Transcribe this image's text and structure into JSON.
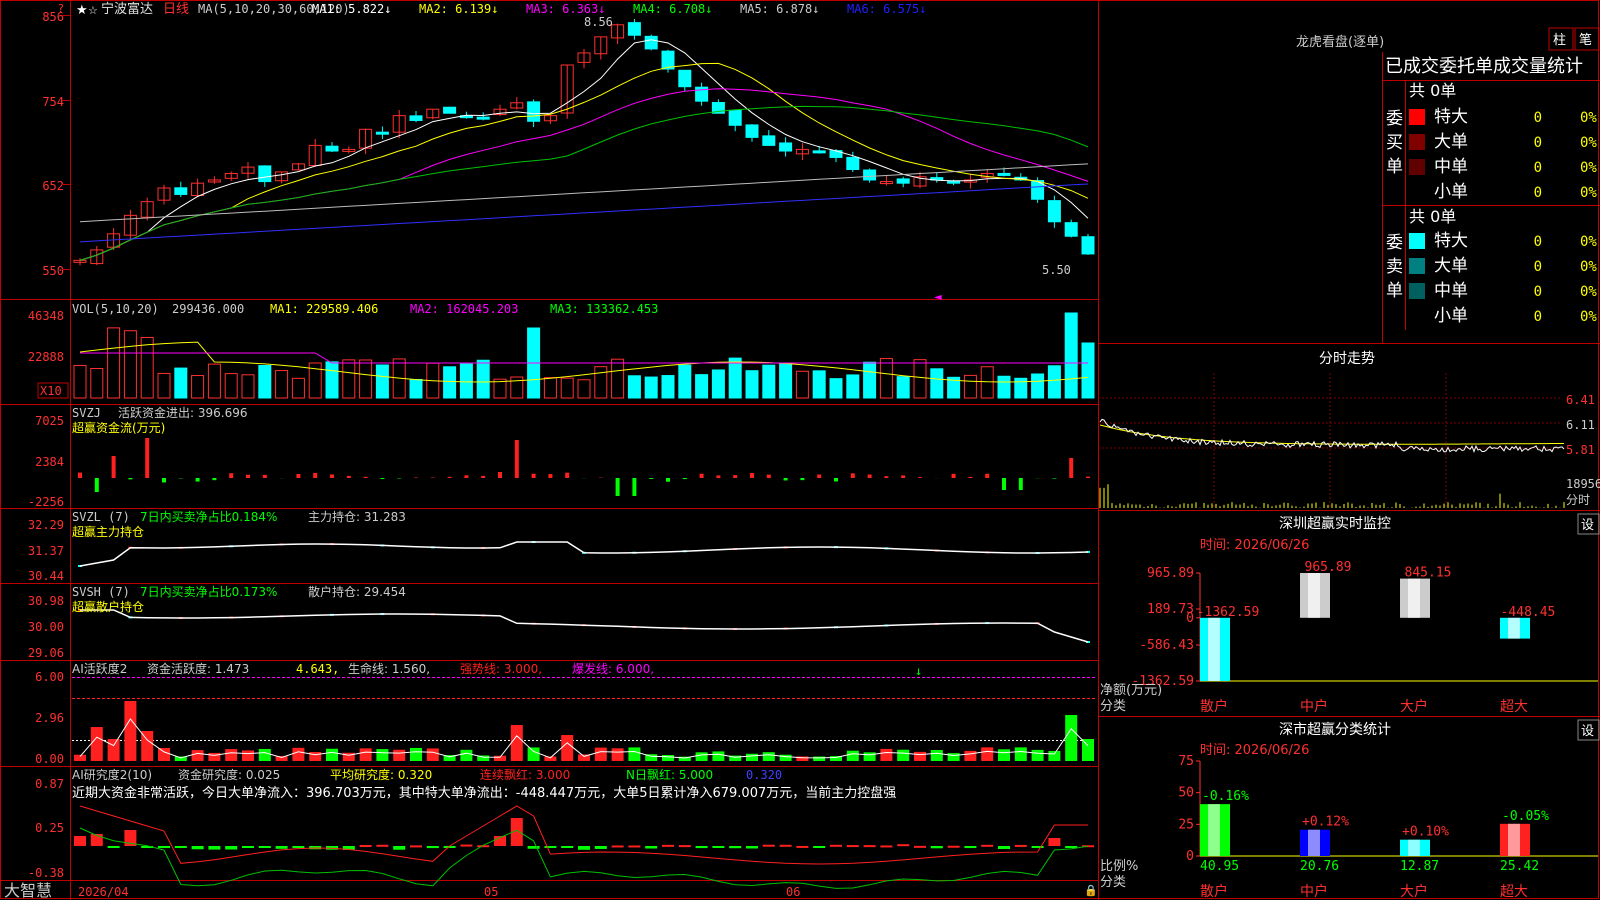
{
  "stock": {
    "name": "宁波富达",
    "period": "日线",
    "ma_label": "MA(5,10,20,30,60,120)",
    "ma_items": [
      {
        "label": "MA1:",
        "value": "5.822",
        "color": "#ffffff"
      },
      {
        "label": "MA2:",
        "value": "6.139",
        "color": "#ffff00"
      },
      {
        "label": "MA3:",
        "value": "6.363",
        "color": "#ff00ff"
      },
      {
        "label": "MA4:",
        "value": "6.708",
        "color": "#00ff00"
      },
      {
        "label": "MA5:",
        "value": "6.878",
        "color": "#cccccc"
      },
      {
        "label": "MA6:",
        "value": "6.575",
        "color": "#2020ff"
      }
    ],
    "price_ticks": [
      "856",
      "754",
      "652",
      "550"
    ],
    "high_label": "8.56",
    "low_label": "5.50"
  },
  "vol": {
    "title": "VOL(5,10,20)",
    "value": "299436.000",
    "ma1": "MA1: 229589.406",
    "ma2": "MA2: 162045.203",
    "ma3": "MA3: 133362.453",
    "ticks": [
      "46348",
      "22888"
    ],
    "unit": "X10"
  },
  "svzj": {
    "title": "SVZJ",
    "label": "活跃资金进出: 396.696",
    "subtitle": "超赢资金流(万元)",
    "ticks": [
      "7025",
      "2384",
      "-2256"
    ]
  },
  "svzl": {
    "title": "SVZL (7)",
    "desc": "7日内买卖净占比0.184%",
    "hold": "主力持仓: 31.283",
    "subtitle": "超赢主力持仓",
    "ticks": [
      "32.29",
      "31.37",
      "30.44"
    ]
  },
  "svsh": {
    "title": "SVSH (7)",
    "desc": "7日内买卖净占比0.173%",
    "hold": "散户持仓: 29.454",
    "subtitle": "超赢散户持仓",
    "ticks": [
      "30.98",
      "30.00",
      "29.06"
    ]
  },
  "ai1": {
    "title": "AI活跃度2",
    "a": "资金活跃度: 1.473",
    "b": "4.643,",
    "c": "生命线: 1.560,",
    "d": "强势线: 3.000,",
    "e": "爆发线: 6.000,",
    "ticks": [
      "6.00",
      "2.96",
      "0.00"
    ]
  },
  "ai2": {
    "title": "AI研究度2(10)",
    "a": "资金研究度: 0.025",
    "b": "平均研究度: 0.320",
    "c": "连续飘红: 3.000",
    "d": "N日飘红: 5.000",
    "e": "0.320",
    "comment": "近期大资金非常活跃，今日大单净流入：396.703万元，其中特大单净流出：-448.447万元，大单5日累计净入679.007万元，当前主力控盘强",
    "ticks": [
      "0.87",
      "0.25",
      "-0.38"
    ]
  },
  "dates": [
    "2026/04",
    "05",
    "06"
  ],
  "brand": "大智慧",
  "right": {
    "dragon": "龙虎看盘(逐单)",
    "btn1": "柱",
    "btn2": "笔",
    "stats_title": "已成交委托单成交量统计",
    "buy_label": "委买单",
    "sell_label": "委卖单",
    "buy_total": "共 0单",
    "sell_total": "共 0单",
    "buy_rows": [
      {
        "label": "特大",
        "val": "0",
        "pct": "0%",
        "color": "#ff0000"
      },
      {
        "label": "大单",
        "val": "0",
        "pct": "0%",
        "color": "#800000"
      },
      {
        "label": "中单",
        "val": "0",
        "pct": "0%",
        "color": "#600000"
      },
      {
        "label": "小单",
        "val": "0",
        "pct": "0%",
        "color": ""
      }
    ],
    "sell_rows": [
      {
        "label": "特大",
        "val": "0",
        "pct": "0%",
        "color": "#00ffff"
      },
      {
        "label": "大单",
        "val": "0",
        "pct": "0%",
        "color": "#008080"
      },
      {
        "label": "中单",
        "val": "0",
        "pct": "0%",
        "color": "#006060"
      },
      {
        "label": "小单",
        "val": "0",
        "pct": "0%",
        "color": ""
      }
    ],
    "fenshi_title": "分时走势",
    "fenshi_ticks": [
      "6.41",
      "6.11",
      "5.81"
    ],
    "fenshi_vol": "18956",
    "fenshi_label": "分时",
    "monitor_title": "深圳超赢实时监控",
    "set": "设",
    "monitor_time": "时间: 2026/06/26",
    "monitor_ticks": [
      "965.89",
      "189.73",
      "0",
      "-586.43",
      "-1362.59"
    ],
    "monitor_axis1": "净额(万元)",
    "monitor_axis2": "分类",
    "cats": [
      "散户",
      "中户",
      "大户",
      "超大"
    ],
    "stat_title": "深市超赢分类统计",
    "stat_time": "时间: 2026/06/26",
    "stat_ticks": [
      "75",
      "50",
      "25",
      "0"
    ],
    "stat_axis1": "比例%",
    "stat_axis2": "分类"
  },
  "chart_data": [
    {
      "type": "bar",
      "title": "深圳超赢实时监控",
      "ylabel": "净额(万元)",
      "categories": [
        "散户",
        "中户",
        "大户",
        "超大"
      ],
      "values": [
        -1362.59,
        965.89,
        845.15,
        -448.45
      ],
      "ylim": [
        -1362.59,
        965.89
      ]
    },
    {
      "type": "bar",
      "title": "深市超赢分类统计",
      "ylabel": "比例%",
      "categories": [
        "散户",
        "中户",
        "大户",
        "超大"
      ],
      "values": [
        40.95,
        20.76,
        12.87,
        25.42
      ],
      "changes": [
        "-0.16%",
        "+0.12%",
        "+0.10%",
        "-0.05%"
      ],
      "ylim": [
        0,
        75
      ]
    }
  ]
}
